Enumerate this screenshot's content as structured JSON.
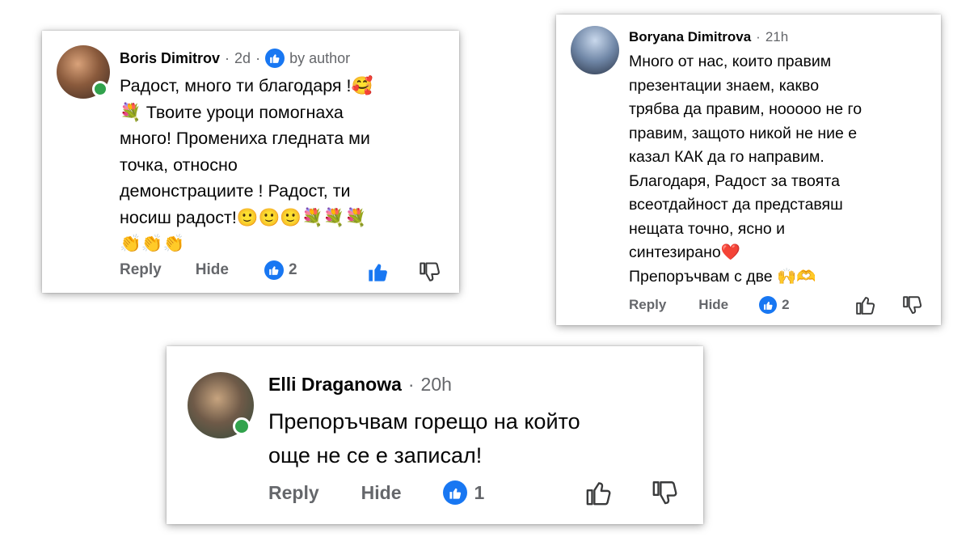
{
  "colors": {
    "accent": "#1877f2",
    "online": "#31a24c",
    "text": "#050505",
    "muted": "#65676b",
    "heart": "#e0245e"
  },
  "comments": [
    {
      "author": "Boris Dimitrov",
      "time": "2d",
      "sep1": "·",
      "sep2": "·",
      "author_badge": "by author",
      "lines": [
        "Радост, много ти благодаря !🥰",
        "💐 Твоите уроци помогнаха",
        "много! Промениха гледната ми",
        "точка, относно",
        "демонстрациите ! Радост, ти",
        "носиш радост!🙂🙂🙂💐💐💐",
        "👏👏👏"
      ],
      "reply_label": "Reply",
      "hide_label": "Hide",
      "like_count": "2",
      "liked": true
    },
    {
      "author": "Boryana Dimitrova",
      "time": "21h",
      "sep1": "·",
      "lines": [
        "Много от нас, които правим",
        "презентации знаем, какво",
        "трябва да правим, нооооо не го",
        "правим, защото никой не ние е",
        "казал КАК да го направим.",
        "Благодаря, Радост за твоята",
        "всеотдайност да представяш",
        "нещата точно, ясно и",
        "синтезирано❤️",
        "Препоръчвам с две 🙌🫶"
      ],
      "reply_label": "Reply",
      "hide_label": "Hide",
      "like_count": "2",
      "liked": false
    },
    {
      "author": "Elli Draganowa",
      "time": "20h",
      "sep1": "·",
      "lines": [
        "Препоръчвам горещо на който",
        "още не се е записал!"
      ],
      "reply_label": "Reply",
      "hide_label": "Hide",
      "like_count": "1",
      "liked": false
    }
  ]
}
